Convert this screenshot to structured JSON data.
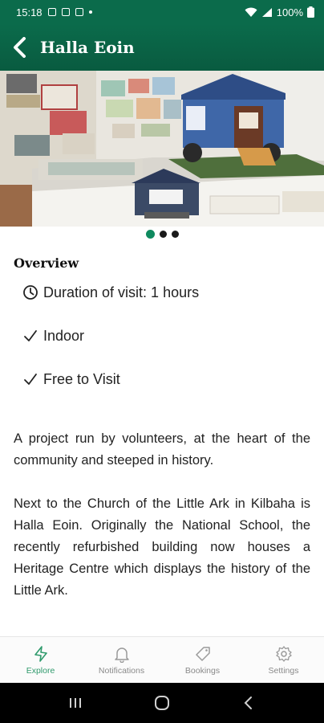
{
  "status": {
    "time": "15:18",
    "battery": "100%"
  },
  "header": {
    "title": "Halla Eoin",
    "back_icon": "back-arrow-icon"
  },
  "carousel": {
    "total": 3,
    "active_index": 0
  },
  "overview": {
    "title": "Overview",
    "features": [
      {
        "icon": "clock-icon",
        "label": "Duration of visit: 1 hours"
      },
      {
        "icon": "check-icon",
        "label": "Indoor"
      },
      {
        "icon": "check-icon",
        "label": "Free to Visit"
      }
    ]
  },
  "description": {
    "paragraph1": "A project run by volunteers, at the heart of the community and steeped in history.",
    "paragraph2": "Next to the Church of the Little Ark in Kilbaha is Halla Eoin. Originally the National School, the recently refurbished building now houses a Heritage Centre which displays the history of the Little Ark."
  },
  "bottom_nav": {
    "items": [
      {
        "label": "Explore",
        "icon": "explore-icon",
        "active": true
      },
      {
        "label": "Notifications",
        "icon": "bell-icon",
        "active": false
      },
      {
        "label": "Bookings",
        "icon": "tag-icon",
        "active": false
      },
      {
        "label": "Settings",
        "icon": "gear-icon",
        "active": false
      }
    ]
  },
  "colors": {
    "primary": "#0b6b4b",
    "accent": "#2f9a6c",
    "active_dot": "#0f8a5f"
  }
}
